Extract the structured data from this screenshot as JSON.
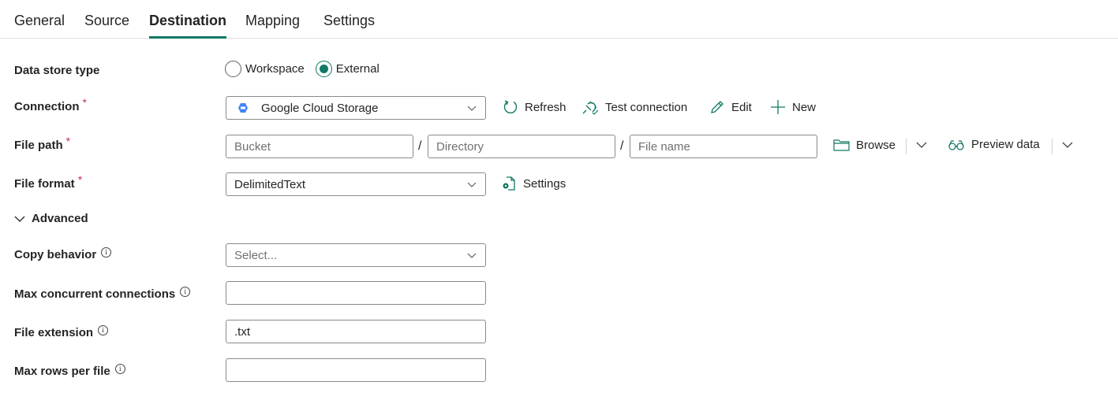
{
  "tabs": [
    {
      "label": "General",
      "active": false
    },
    {
      "label": "Source",
      "active": false
    },
    {
      "label": "Destination",
      "active": true
    },
    {
      "label": "Mapping",
      "active": false
    },
    {
      "label": "Settings",
      "active": false
    }
  ],
  "accent_color": "#117865",
  "form": {
    "data_store_type": {
      "label": "Data store type",
      "options": [
        "Workspace",
        "External"
      ],
      "selected": "External"
    },
    "connection": {
      "label": "Connection",
      "required_mark": "*",
      "value": "Google Cloud Storage",
      "icon": "google-cloud-storage-icon",
      "actions": {
        "refresh": "Refresh",
        "test_connection": "Test connection",
        "edit": "Edit",
        "new": "New"
      }
    },
    "file_path": {
      "label": "File path",
      "required_mark": "*",
      "separator": "/",
      "bucket_placeholder": "Bucket",
      "directory_placeholder": "Directory",
      "file_name_placeholder": "File name",
      "bucket_value": "",
      "directory_value": "",
      "file_name_value": "",
      "actions": {
        "browse": "Browse",
        "preview_data": "Preview data"
      }
    },
    "file_format": {
      "label": "File format",
      "required_mark": "*",
      "value": "DelimitedText",
      "settings_label": "Settings"
    },
    "advanced": {
      "label": "Advanced",
      "expanded": true
    },
    "copy_behavior": {
      "label": "Copy behavior",
      "placeholder": "Select...",
      "info": "i"
    },
    "max_concurrent_connections": {
      "label": "Max concurrent connections",
      "value": "",
      "info": "i"
    },
    "file_extension": {
      "label": "File extension",
      "value": ".txt",
      "info": "i"
    },
    "max_rows_per_file": {
      "label": "Max rows per file",
      "value": "",
      "info": "i"
    }
  }
}
